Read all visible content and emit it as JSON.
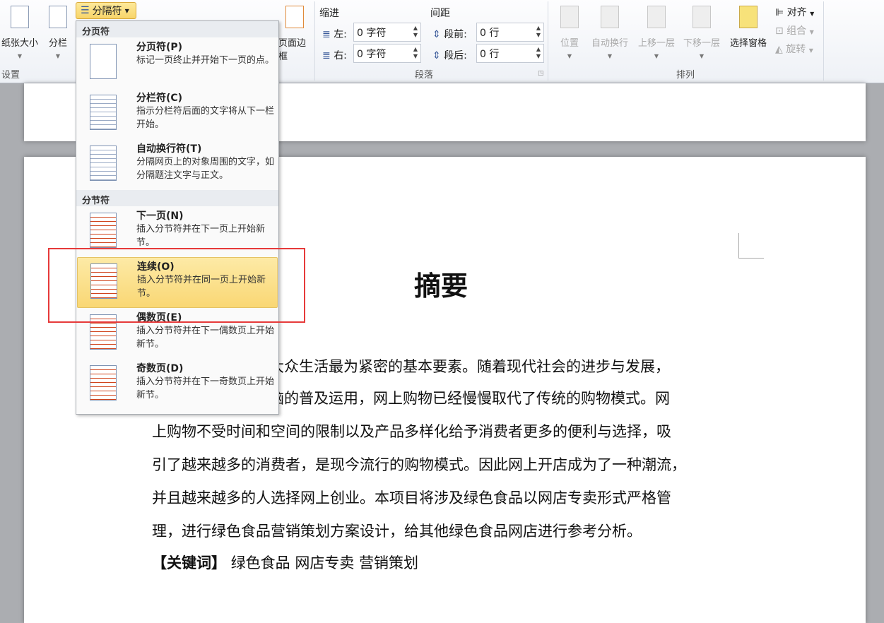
{
  "ribbon": {
    "page_setup": {
      "size": "纸张大小",
      "columns": "分栏",
      "group": "设置",
      "breaks": "分隔符",
      "page_borders": "页面边框"
    },
    "paragraph": {
      "indent": "缩进",
      "spacing": "间距",
      "left_label": "左:",
      "left_value": "0 字符",
      "right_label": "右:",
      "right_value": "0 字符",
      "before_label": "段前:",
      "before_value": "0 行",
      "after_label": "段后:",
      "after_value": "0 行",
      "group": "段落"
    },
    "arrange": {
      "position": "位置",
      "wrap": "自动换行",
      "forward": "上移一层",
      "backward": "下移一层",
      "pane": "选择窗格",
      "align": "对齐",
      "group_btn": "组合",
      "rotate": "旋转",
      "group": "排列"
    }
  },
  "menu": {
    "page_breaks_header": "分页符",
    "section_breaks_header": "分节符",
    "items": [
      {
        "title": "分页符(P)",
        "desc": "标记一页终止并开始下一页的点。"
      },
      {
        "title": "分栏符(C)",
        "desc": "指示分栏符后面的文字将从下一栏开始。"
      },
      {
        "title": "自动换行符(T)",
        "desc": "分隔网页上的对象周围的文字，如分隔题注文字与正文。"
      },
      {
        "title": "下一页(N)",
        "desc": "插入分节符并在下一页上开始新节。"
      },
      {
        "title": "连续(O)",
        "desc": "插入分节符并在同一页上开始新节。"
      },
      {
        "title": "偶数页(E)",
        "desc": "插入分节符并在下一偶数页上开始新节。"
      },
      {
        "title": "奇数页(D)",
        "desc": "插入分节符并在下一奇数页上开始新节。"
      }
    ]
  },
  "document": {
    "title": "摘要",
    "lines": [
      "和大众生活最为紧密的基本要素。随着现代社会的进步与发展，",
      "电脑的普及运用，网上购物已经慢慢取代了传统的购物模式。网",
      "上购物不受时间和空间的限制以及产品多样化给予消费者更多的便利与选择，吸",
      "引了越来越多的消费者，是现今流行的购物模式。因此网上开店成为了一种潮流，",
      "并且越来越多的人选择网上创业。本项目将涉及绿色食品以网店专卖形式严格管",
      "理，进行绿色食品营销策划方案设计，给其他绿色食品网店进行参考分析。"
    ],
    "keywords_label": "【关键词】",
    "keywords": "绿色食品  网店专卖  营销策划"
  }
}
